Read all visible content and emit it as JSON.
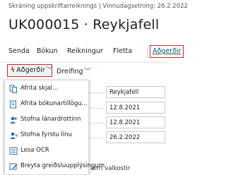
{
  "header": {
    "breadcrumb": "Skráning uppskriftarreiknings | Vinnudagsetning: 26.2.2022",
    "title": "UK000015 · Reykjafell"
  },
  "actionbar": {
    "items": [
      "Senda",
      "Bókun",
      "Reikningur",
      "Fletta"
    ],
    "actions_label": "Aðgerðir"
  },
  "subbar": {
    "actions_label": "Aðgerðir",
    "process_label": "Dreifing"
  },
  "menu": {
    "items": [
      {
        "label": "Afrita skjal...",
        "icon": "copy-document-icon"
      },
      {
        "label": "Afrita bókunartillögu...",
        "icon": "copy-posting-icon"
      },
      {
        "label": "Stofna lánardrottinn",
        "icon": "create-vendor-icon"
      },
      {
        "label": "Stofna fyrstu línu",
        "icon": "create-first-line-icon"
      },
      {
        "label": "Lesa OCR",
        "icon": "ocr-icon"
      },
      {
        "label": "Breyta greiðsluupplýsingum",
        "icon": "edit-payment-icon"
      }
    ]
  },
  "form": {
    "fields": [
      "Reykjafell",
      "12.8.2021",
      "12.8.2021",
      "26.2.2022"
    ],
    "footer_text": "ærri valkostir"
  },
  "colors": {
    "accent": "#00606b",
    "highlight_border": "#e02020",
    "menu_icon": "#2a6fb3"
  }
}
